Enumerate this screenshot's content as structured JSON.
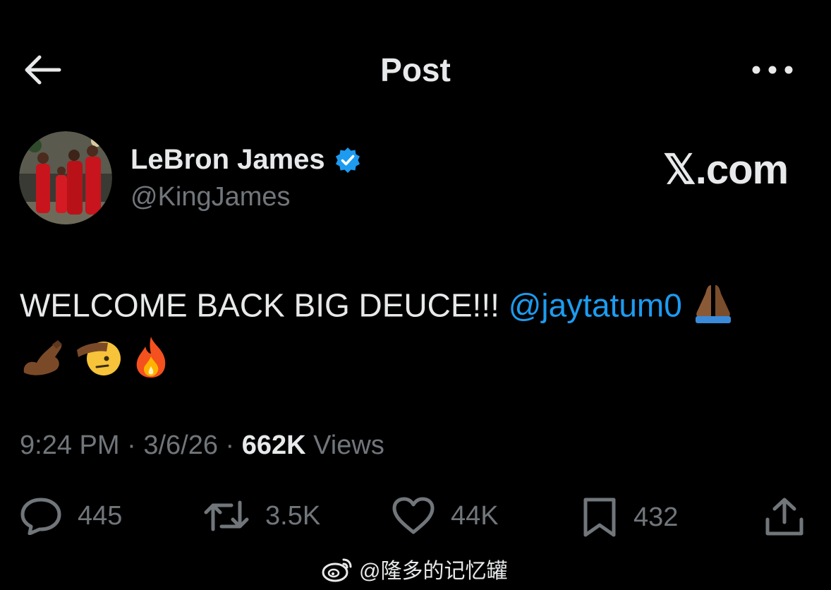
{
  "header": {
    "title": "Post",
    "back_icon": "arrow-left-icon",
    "more_icon": "more-horizontal-icon"
  },
  "author": {
    "name": "LeBron James",
    "handle": "@KingJames",
    "verified_icon": "verified-badge-icon",
    "verified_color": "#1d9bf0"
  },
  "brand": {
    "logo_text": "𝕏.com"
  },
  "tweet": {
    "text_main": "WELCOME BACK BIG DEUCE!!! ",
    "mention": "@jaytatum0",
    "emojis": [
      "folded-hands-icon",
      "flexed-biceps-icon",
      "saluting-face-icon",
      "fire-icon"
    ]
  },
  "meta": {
    "time": "9:24 PM",
    "separator": " · ",
    "date": "3/6/26",
    "views_count": "662K",
    "views_label": " Views"
  },
  "actions": {
    "replies": "445",
    "reposts": "3.5K",
    "likes": "44K",
    "bookmarks": "432"
  },
  "watermark": {
    "text": "@隆多的记忆罐"
  },
  "colors": {
    "background": "#000000",
    "primary_text": "#e7e9ea",
    "secondary_text": "#71767b",
    "accent": "#1d9bf0"
  }
}
